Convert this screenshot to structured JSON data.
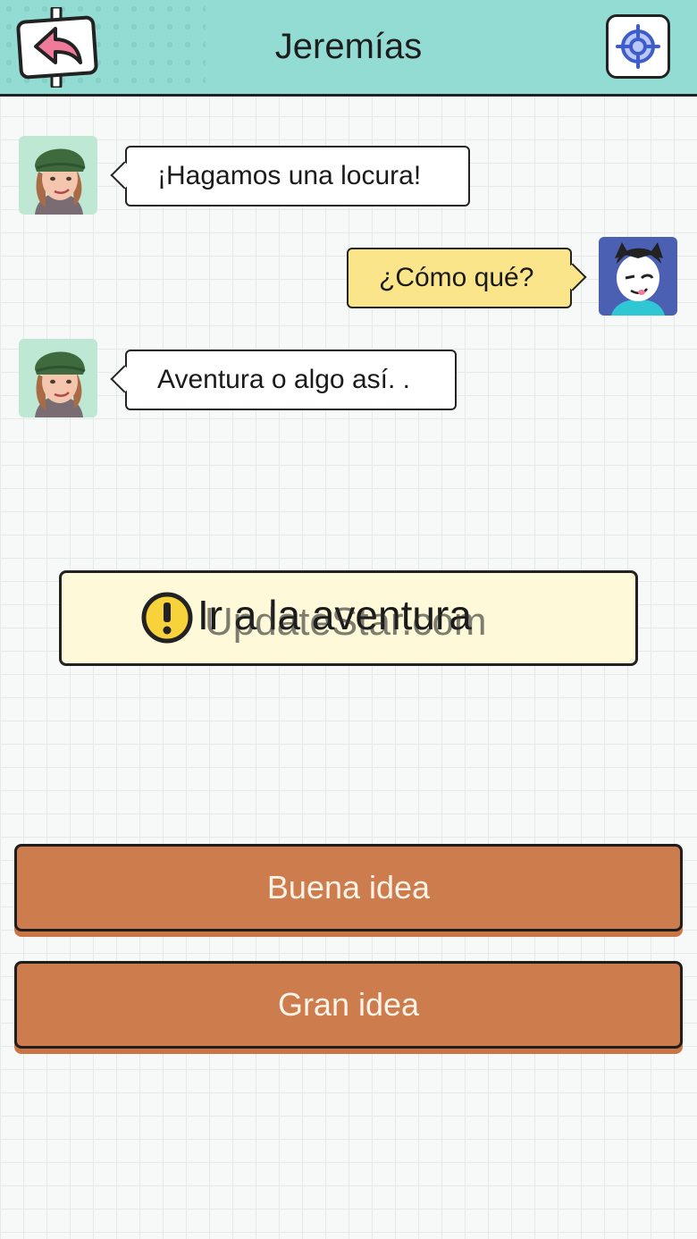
{
  "header": {
    "title": "Jeremías",
    "back_icon": "back-arrow-sign-icon",
    "target_icon": "crosshair-icon"
  },
  "messages": [
    {
      "side": "left",
      "text": "¡Hagamos una locura!",
      "avatar": "girl-green-beanie-avatar"
    },
    {
      "side": "right",
      "text": "¿Cómo qué?",
      "avatar": "boy-winking-avatar"
    },
    {
      "side": "left",
      "text": "Aventura o algo así. .",
      "avatar": "girl-green-beanie-avatar"
    }
  ],
  "notice": {
    "icon": "exclamation-circle-icon",
    "text": "Ir a la aventura",
    "watermark": "UpdateStar.com"
  },
  "choices": [
    {
      "label": "Buena idea"
    },
    {
      "label": "Gran idea"
    }
  ],
  "colors": {
    "header_bg": "#93dcd3",
    "player_bubble": "#fae58b",
    "choice_button": "#cd7c4e",
    "notice_bg": "#fef9d8"
  }
}
